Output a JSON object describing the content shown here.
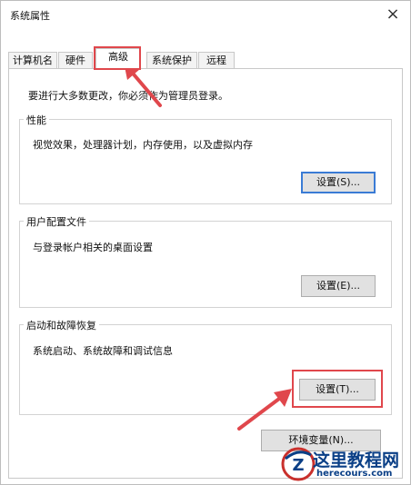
{
  "window": {
    "title": "系统属性",
    "close_glyph": "×"
  },
  "tabs": [
    {
      "label": "计算机名",
      "active": false
    },
    {
      "label": "硬件",
      "active": false
    },
    {
      "label": "高级",
      "active": true
    },
    {
      "label": "系统保护",
      "active": false
    },
    {
      "label": "远程",
      "active": false
    }
  ],
  "notice": "要进行大多数更改，你必须作为管理员登录。",
  "groups": {
    "performance": {
      "title": "性能",
      "desc": "视觉效果，处理器计划，内存使用，以及虚拟内存",
      "button": "设置(S)..."
    },
    "user_profiles": {
      "title": "用户配置文件",
      "desc": "与登录帐户相关的桌面设置",
      "button": "设置(E)..."
    },
    "startup_recovery": {
      "title": "启动和故障恢复",
      "desc": "系统启动、系统故障和调试信息",
      "button": "设置(T)..."
    }
  },
  "env_button": "环境变量(N)...",
  "watermark": {
    "text": "这里教程网",
    "url": "herecours.com",
    "logo_letter": "Z"
  },
  "colors": {
    "highlight": "#e0474c",
    "focus": "#3a7bd5",
    "watermark": "#0a3f86"
  }
}
